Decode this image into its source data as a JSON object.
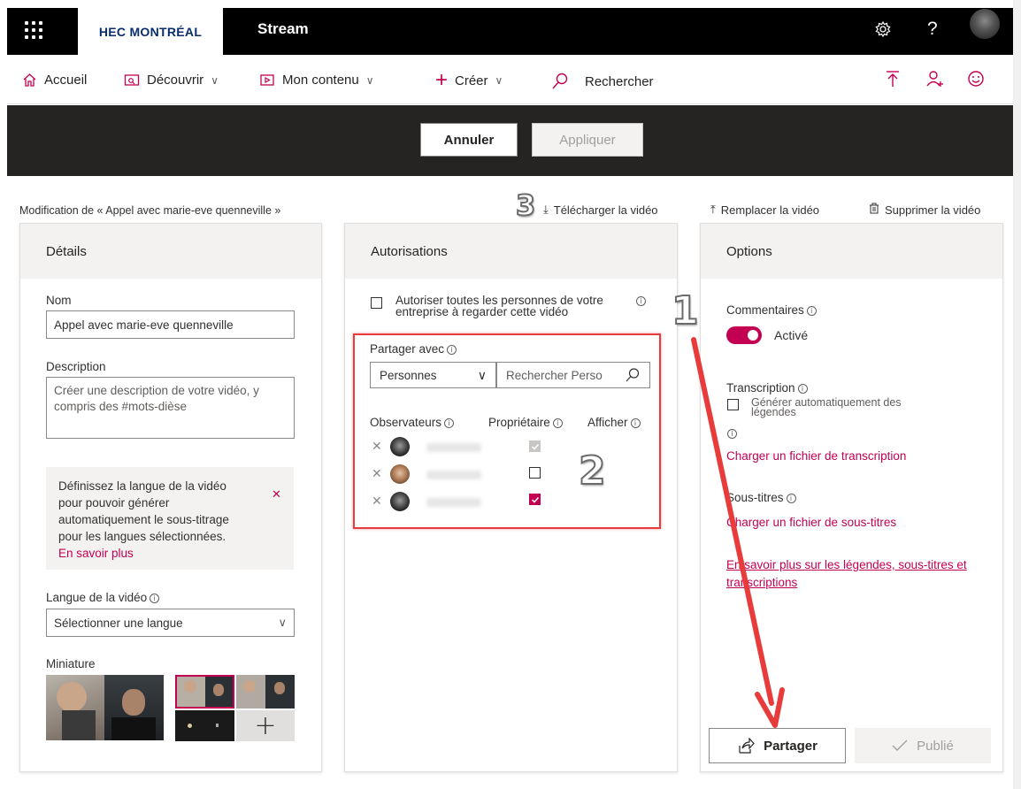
{
  "header": {
    "brand": "HEC MONTRÉAL",
    "app_name": "Stream",
    "help": "?"
  },
  "nav": {
    "home": "Accueil",
    "discover": "Découvrir",
    "my_content": "Mon contenu",
    "create": "Créer",
    "search": "Rechercher"
  },
  "toolbar": {
    "cancel": "Annuler",
    "apply": "Appliquer"
  },
  "breadcrumb": "Modification de « Appel avec marie-eve quenneville »",
  "actions": {
    "download": "Télécharger la vidéo",
    "replace": "Remplacer la vidéo",
    "delete": "Supprimer la vidéo"
  },
  "details": {
    "title": "Détails",
    "name_label": "Nom",
    "name_value": "Appel avec marie-eve quenneville",
    "description_label": "Description",
    "description_placeholder": "Créer une description de votre vidéo, y compris des #mots-dièse",
    "tip_text": "Définissez la langue de la vidéo pour pouvoir générer automatiquement le sous-titrage pour les langues sélectionnées.",
    "tip_link": "En savoir plus",
    "language_label": "Langue de la vidéo",
    "language_value": "Sélectionner une langue",
    "thumbnail_label": "Miniature"
  },
  "permissions": {
    "title": "Autorisations",
    "allow_all": "Autoriser toutes les personnes de votre entreprise à regarder cette vidéo",
    "share_with": "Partager avec",
    "share_type": "Personnes",
    "search_placeholder": "Rechercher Perso",
    "col_viewers": "Observateurs",
    "col_owner": "Propriétaire",
    "col_show": "Afficher",
    "people": [
      {
        "owner": "disabled-checked"
      },
      {
        "owner": "unchecked"
      },
      {
        "owner": "checked"
      }
    ]
  },
  "options": {
    "title": "Options",
    "comments_label": "Commentaires",
    "comments_state": "Activé",
    "transcript_label": "Transcription",
    "auto_captions": "Générer automatiquement des légendes",
    "upload_transcript": "Charger un fichier de transcription",
    "subtitles_label": "Sous-titres",
    "upload_subtitles": "Charger un fichier de sous-titres",
    "learn_more": "En savoir plus sur les légendes, sous-titres et transcriptions"
  },
  "footer": {
    "share": "Partager",
    "published": "Publié"
  },
  "annotations": [
    "1",
    "2",
    "3"
  ],
  "colors": {
    "accent": "#c30052",
    "annotation_red": "#e83b3b",
    "dark_bar": "#252423"
  }
}
